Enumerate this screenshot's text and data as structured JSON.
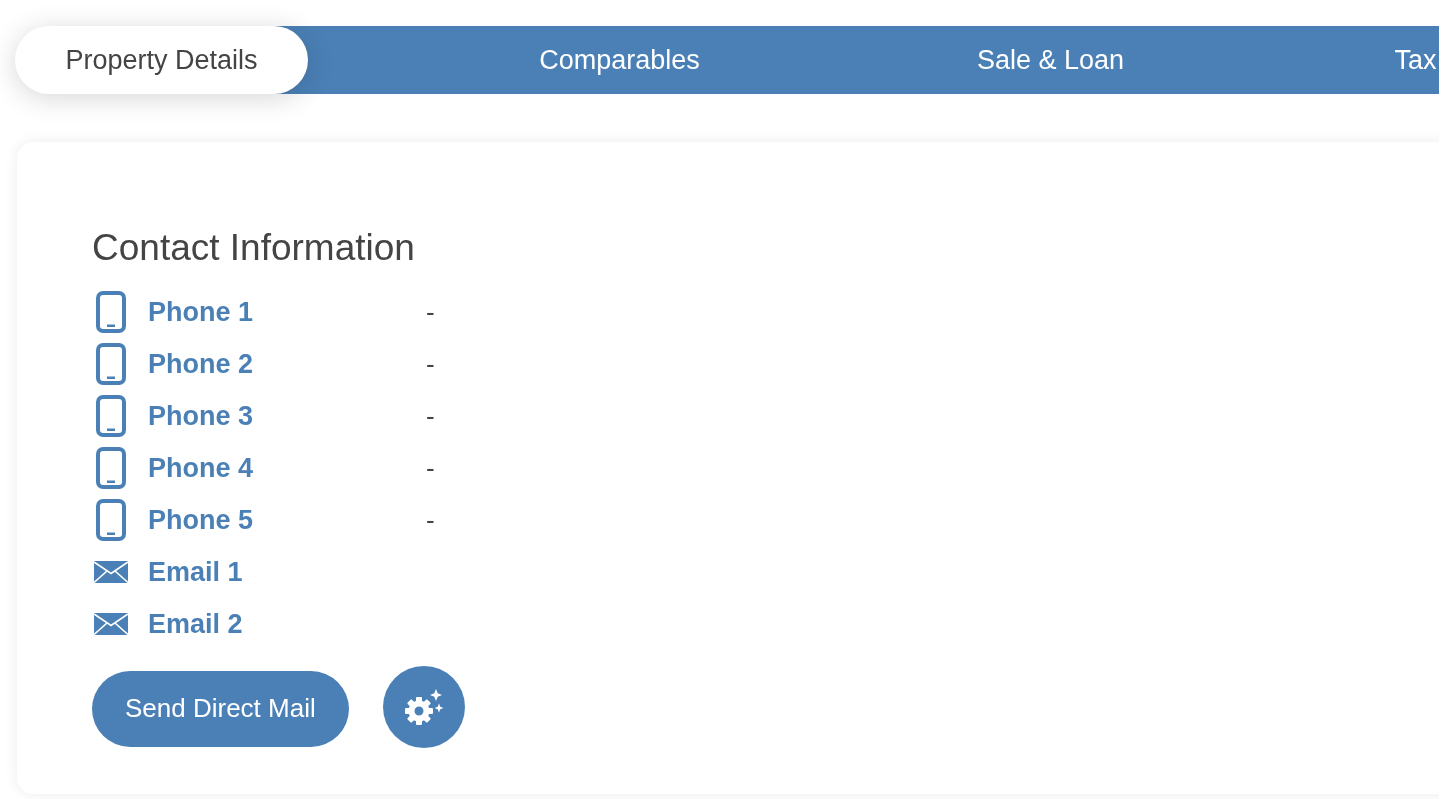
{
  "tabs": [
    {
      "label": "Property Details",
      "selected": true
    },
    {
      "label": "Comparables",
      "selected": false
    },
    {
      "label": "Sale & Loan",
      "selected": false
    },
    {
      "label": "Tax",
      "selected": false
    }
  ],
  "contact_information": {
    "title": "Contact Information",
    "rows": [
      {
        "kind": "phone",
        "label": "Phone 1",
        "value": "-"
      },
      {
        "kind": "phone",
        "label": "Phone 2",
        "value": "-"
      },
      {
        "kind": "phone",
        "label": "Phone 3",
        "value": "-"
      },
      {
        "kind": "phone",
        "label": "Phone 4",
        "value": "-"
      },
      {
        "kind": "phone",
        "label": "Phone 5",
        "value": "-"
      },
      {
        "kind": "email",
        "label": "Email 1"
      },
      {
        "kind": "email",
        "label": "Email 2"
      }
    ],
    "send_button": {
      "label": "Send Direct Mail"
    }
  }
}
